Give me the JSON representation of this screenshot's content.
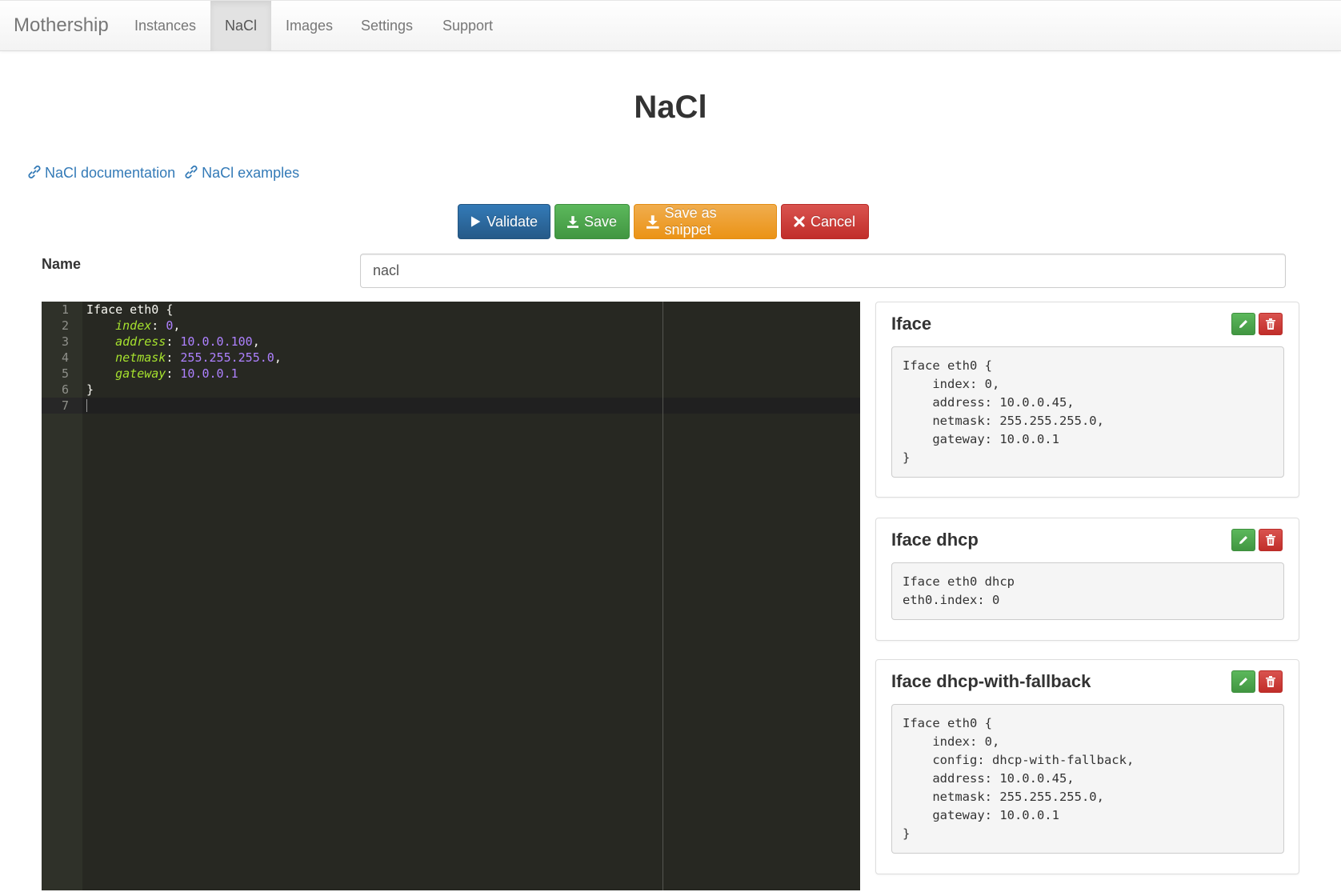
{
  "nav": {
    "brand": "Mothership",
    "items": [
      {
        "label": "Instances",
        "active": false
      },
      {
        "label": "NaCl",
        "active": true
      },
      {
        "label": "Images",
        "active": false
      },
      {
        "label": "Settings",
        "active": false
      },
      {
        "label": "Support",
        "active": false
      }
    ]
  },
  "page": {
    "title": "NaCl",
    "links": {
      "documentation": "NaCl documentation",
      "examples": "NaCl examples"
    }
  },
  "toolbar": {
    "validate_label": "Validate",
    "save_label": "Save",
    "save_snippet_label": "Save as snippet",
    "cancel_label": "Cancel"
  },
  "form": {
    "name_label": "Name",
    "name_value": "nacl"
  },
  "editor": {
    "lines": [
      {
        "no": "1",
        "text": "Iface eth0 {"
      },
      {
        "no": "2",
        "key": "index",
        "value": "0"
      },
      {
        "no": "3",
        "key": "address",
        "value": "10.0.0.100"
      },
      {
        "no": "4",
        "key": "netmask",
        "value": "255.255.255.0"
      },
      {
        "no": "5",
        "key": "gateway",
        "value": "10.0.0.1"
      },
      {
        "no": "6",
        "text": "}"
      },
      {
        "no": "7",
        "text": ""
      }
    ]
  },
  "snippets": [
    {
      "title": "Iface",
      "code": "Iface eth0 {\n    index: 0,\n    address: 10.0.0.45,\n    netmask: 255.255.255.0,\n    gateway: 10.0.0.1\n}"
    },
    {
      "title": "Iface dhcp",
      "code": "Iface eth0 dhcp\neth0.index: 0"
    },
    {
      "title": "Iface dhcp-with-fallback",
      "code": "Iface eth0 {\n    index: 0,\n    config: dhcp-with-fallback,\n    address: 10.0.0.45,\n    netmask: 255.255.255.0,\n    gateway: 10.0.0.1\n}"
    }
  ],
  "colors": {
    "primary": "#337ab7",
    "success": "#5cb85c",
    "warning": "#f0ad4e",
    "danger": "#d9534f",
    "editor_bg": "#272822",
    "editor_key": "#a6e22e",
    "editor_value": "#ae81ff"
  }
}
